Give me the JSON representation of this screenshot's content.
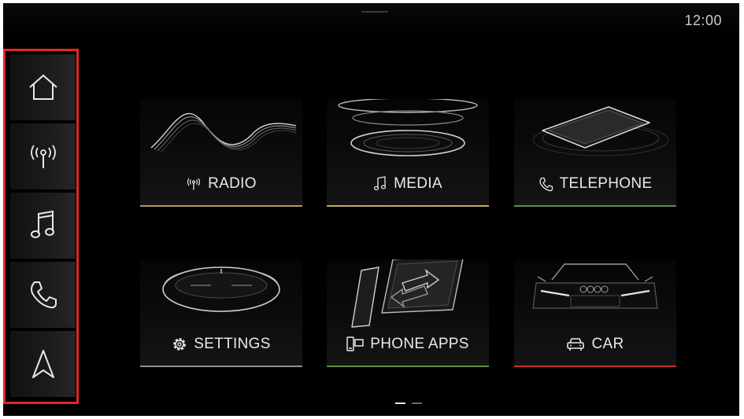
{
  "status_bar": {
    "time": "12:00"
  },
  "sidebar": {
    "items": [
      {
        "name": "home",
        "icon": "home-icon"
      },
      {
        "name": "radio",
        "icon": "radio-antenna-icon"
      },
      {
        "name": "media",
        "icon": "music-note-icon"
      },
      {
        "name": "telephone",
        "icon": "phone-handset-icon"
      },
      {
        "name": "navigation",
        "icon": "navigation-arrow-icon"
      }
    ],
    "highlight_color": "#e12727"
  },
  "tiles": [
    {
      "label": "RADIO",
      "icon": "radio-antenna-icon",
      "accent": "#c2915c"
    },
    {
      "label": "MEDIA",
      "icon": "music-note-icon",
      "accent": "#c9a866"
    },
    {
      "label": "TELEPHONE",
      "icon": "phone-handset-icon",
      "accent": "#5f8f46"
    },
    {
      "label": "SETTINGS",
      "icon": "gear-icon",
      "accent": "#8f8f8f"
    },
    {
      "label": "PHONE APPS",
      "icon": "phone-apps-icon",
      "accent": "#5f8f46"
    },
    {
      "label": "CAR",
      "icon": "car-icon",
      "accent": "#c83030"
    }
  ],
  "pagination": {
    "pages": 2,
    "current": 1
  }
}
